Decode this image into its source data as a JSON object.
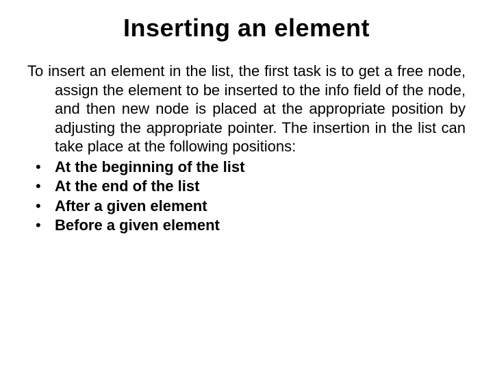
{
  "title": "Inserting an element",
  "intro": "To insert an element in the list, the first task is to get a free node, assign the element to be inserted to the info field  of the node, and then new node is placed at the appropriate position by adjusting the appropriate pointer. The insertion in the list can take place at the following positions:",
  "bullets": [
    "At the beginning of the list",
    "At the end of the list",
    "After a given element",
    "Before a given element"
  ]
}
